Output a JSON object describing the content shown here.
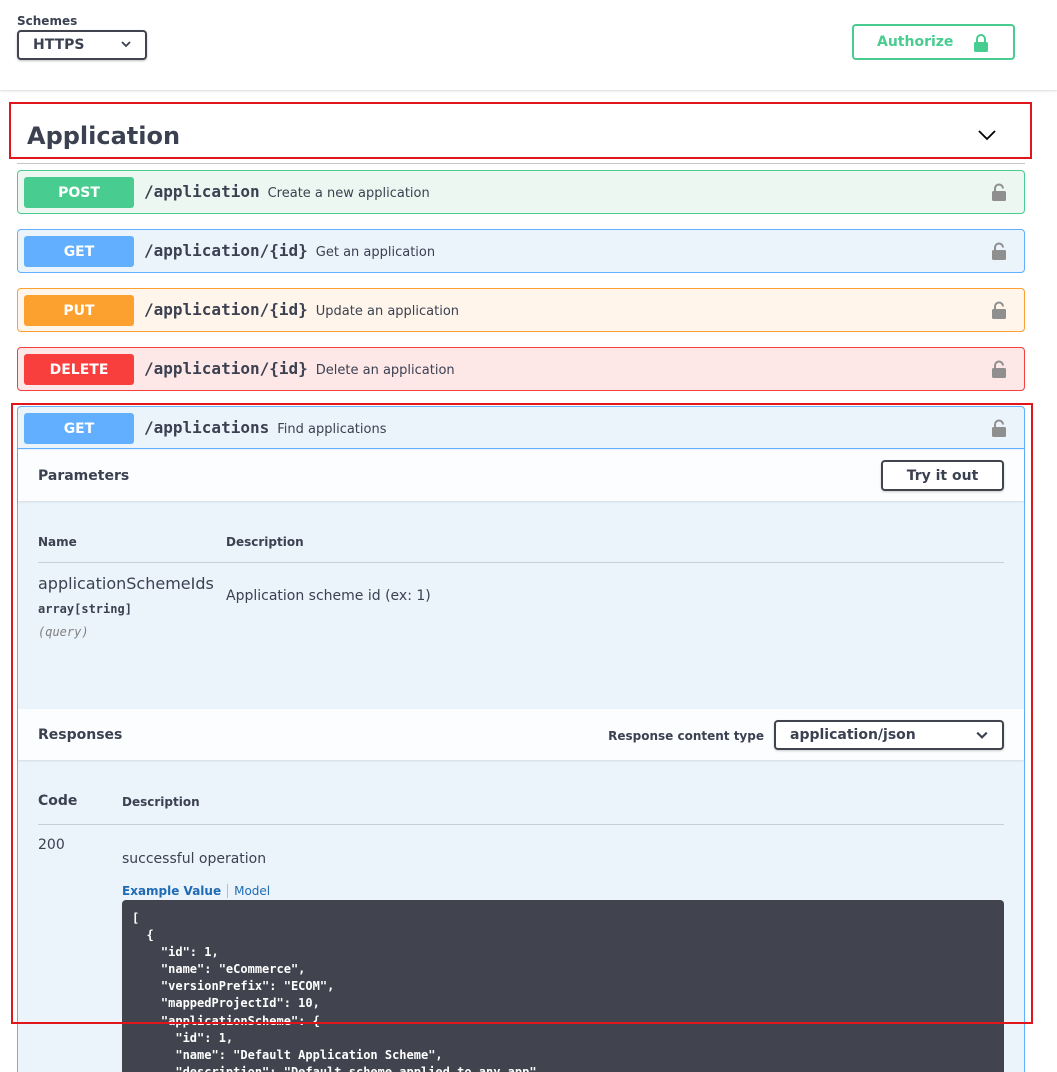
{
  "schemes": {
    "label": "Schemes",
    "selected": "HTTPS"
  },
  "authorize": {
    "label": "Authorize"
  },
  "tag": {
    "title": "Application"
  },
  "operations": [
    {
      "method": "POST",
      "path": "/application",
      "summary": "Create a new application"
    },
    {
      "method": "GET",
      "path": "/application/{id}",
      "summary": "Get an application"
    },
    {
      "method": "PUT",
      "path": "/application/{id}",
      "summary": "Update an application"
    },
    {
      "method": "DELETE",
      "path": "/application/{id}",
      "summary": "Delete an application"
    },
    {
      "method": "GET",
      "path": "/applications",
      "summary": "Find applications"
    }
  ],
  "expanded": {
    "parameters": {
      "title": "Parameters",
      "try_label": "Try it out",
      "col_name": "Name",
      "col_desc": "Description",
      "param_name": "applicationSchemeIds",
      "param_type": "array[string]",
      "param_in": "(query)",
      "param_desc": "Application scheme id (ex: 1)"
    },
    "responses": {
      "title": "Responses",
      "content_type_label": "Response content type",
      "content_type": "application/json",
      "col_code": "Code",
      "col_desc": "Description",
      "code": "200",
      "description": "successful operation",
      "tab_example": "Example Value",
      "tab_model": "Model",
      "example_json": "[\n  {\n    \"id\": 1,\n    \"name\": \"eCommerce\",\n    \"versionPrefix\": \"ECOM\",\n    \"mappedProjectId\": 10,\n    \"applicationScheme\": {\n      \"id\": 1,\n      \"name\": \"Default Application Scheme\",\n      \"description\": \"Default scheme applied to any app\","
    }
  },
  "colors": {
    "post": "#49cc90",
    "get": "#61affe",
    "put": "#fca130",
    "delete": "#f93e3e",
    "highlight": "#e0161c"
  }
}
